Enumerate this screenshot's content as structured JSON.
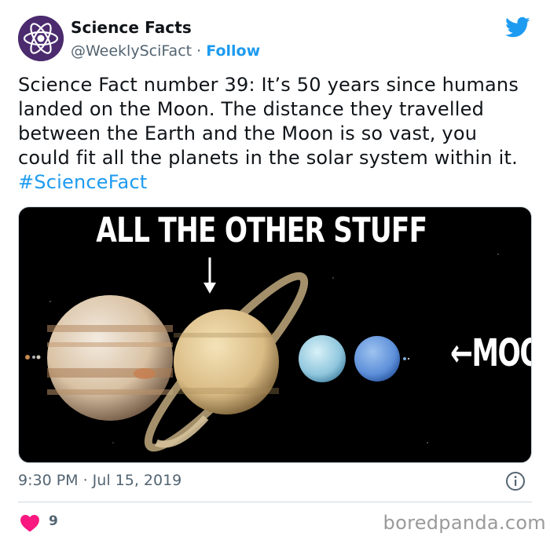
{
  "tweet": {
    "author_name": "Science Facts",
    "handle": "@WeeklySciFact",
    "separator": "·",
    "follow_label": "Follow",
    "text_main": "Science Fact number 39: It’s 50 years since humans landed on the Moon. The distance they travelled between the Earth and the Moon is so vast, you could fit all the planets in the solar system within it.",
    "hashtag": "#ScienceFact",
    "timestamp": "9:30 PM · Jul 15, 2019",
    "like_count": "9"
  },
  "media": {
    "top_caption": "ALL THE OTHER STUFF",
    "moon_label": "←MOON"
  },
  "watermark": "boredpanda.com",
  "colors": {
    "accent": "#1d9bf0",
    "heart": "#f91880",
    "secondary_text": "#536471"
  },
  "icons": [
    "atom-avatar-icon",
    "twitter-bird-icon",
    "info-icon",
    "heart-icon",
    "down-arrow-icon"
  ]
}
